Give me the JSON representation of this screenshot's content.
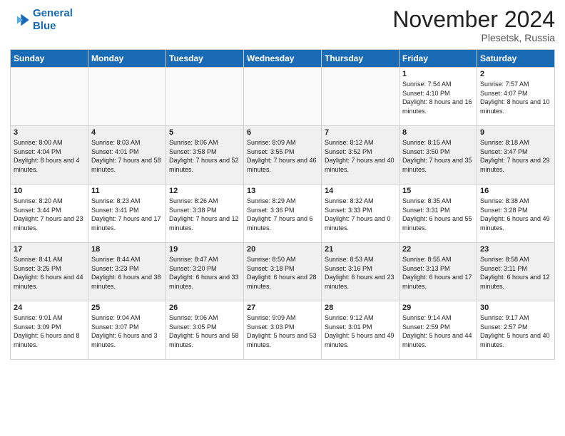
{
  "header": {
    "logo_line1": "General",
    "logo_line2": "Blue",
    "month_title": "November 2024",
    "location": "Plesetsk, Russia"
  },
  "days_of_week": [
    "Sunday",
    "Monday",
    "Tuesday",
    "Wednesday",
    "Thursday",
    "Friday",
    "Saturday"
  ],
  "weeks": [
    [
      {
        "day": "",
        "info": ""
      },
      {
        "day": "",
        "info": ""
      },
      {
        "day": "",
        "info": ""
      },
      {
        "day": "",
        "info": ""
      },
      {
        "day": "",
        "info": ""
      },
      {
        "day": "1",
        "info": "Sunrise: 7:54 AM\nSunset: 4:10 PM\nDaylight: 8 hours and 16 minutes."
      },
      {
        "day": "2",
        "info": "Sunrise: 7:57 AM\nSunset: 4:07 PM\nDaylight: 8 hours and 10 minutes."
      }
    ],
    [
      {
        "day": "3",
        "info": "Sunrise: 8:00 AM\nSunset: 4:04 PM\nDaylight: 8 hours and 4 minutes."
      },
      {
        "day": "4",
        "info": "Sunrise: 8:03 AM\nSunset: 4:01 PM\nDaylight: 7 hours and 58 minutes."
      },
      {
        "day": "5",
        "info": "Sunrise: 8:06 AM\nSunset: 3:58 PM\nDaylight: 7 hours and 52 minutes."
      },
      {
        "day": "6",
        "info": "Sunrise: 8:09 AM\nSunset: 3:55 PM\nDaylight: 7 hours and 46 minutes."
      },
      {
        "day": "7",
        "info": "Sunrise: 8:12 AM\nSunset: 3:52 PM\nDaylight: 7 hours and 40 minutes."
      },
      {
        "day": "8",
        "info": "Sunrise: 8:15 AM\nSunset: 3:50 PM\nDaylight: 7 hours and 35 minutes."
      },
      {
        "day": "9",
        "info": "Sunrise: 8:18 AM\nSunset: 3:47 PM\nDaylight: 7 hours and 29 minutes."
      }
    ],
    [
      {
        "day": "10",
        "info": "Sunrise: 8:20 AM\nSunset: 3:44 PM\nDaylight: 7 hours and 23 minutes."
      },
      {
        "day": "11",
        "info": "Sunrise: 8:23 AM\nSunset: 3:41 PM\nDaylight: 7 hours and 17 minutes."
      },
      {
        "day": "12",
        "info": "Sunrise: 8:26 AM\nSunset: 3:38 PM\nDaylight: 7 hours and 12 minutes."
      },
      {
        "day": "13",
        "info": "Sunrise: 8:29 AM\nSunset: 3:36 PM\nDaylight: 7 hours and 6 minutes."
      },
      {
        "day": "14",
        "info": "Sunrise: 8:32 AM\nSunset: 3:33 PM\nDaylight: 7 hours and 0 minutes."
      },
      {
        "day": "15",
        "info": "Sunrise: 8:35 AM\nSunset: 3:31 PM\nDaylight: 6 hours and 55 minutes."
      },
      {
        "day": "16",
        "info": "Sunrise: 8:38 AM\nSunset: 3:28 PM\nDaylight: 6 hours and 49 minutes."
      }
    ],
    [
      {
        "day": "17",
        "info": "Sunrise: 8:41 AM\nSunset: 3:25 PM\nDaylight: 6 hours and 44 minutes."
      },
      {
        "day": "18",
        "info": "Sunrise: 8:44 AM\nSunset: 3:23 PM\nDaylight: 6 hours and 38 minutes."
      },
      {
        "day": "19",
        "info": "Sunrise: 8:47 AM\nSunset: 3:20 PM\nDaylight: 6 hours and 33 minutes."
      },
      {
        "day": "20",
        "info": "Sunrise: 8:50 AM\nSunset: 3:18 PM\nDaylight: 6 hours and 28 minutes."
      },
      {
        "day": "21",
        "info": "Sunrise: 8:53 AM\nSunset: 3:16 PM\nDaylight: 6 hours and 23 minutes."
      },
      {
        "day": "22",
        "info": "Sunrise: 8:55 AM\nSunset: 3:13 PM\nDaylight: 6 hours and 17 minutes."
      },
      {
        "day": "23",
        "info": "Sunrise: 8:58 AM\nSunset: 3:11 PM\nDaylight: 6 hours and 12 minutes."
      }
    ],
    [
      {
        "day": "24",
        "info": "Sunrise: 9:01 AM\nSunset: 3:09 PM\nDaylight: 6 hours and 8 minutes."
      },
      {
        "day": "25",
        "info": "Sunrise: 9:04 AM\nSunset: 3:07 PM\nDaylight: 6 hours and 3 minutes."
      },
      {
        "day": "26",
        "info": "Sunrise: 9:06 AM\nSunset: 3:05 PM\nDaylight: 5 hours and 58 minutes."
      },
      {
        "day": "27",
        "info": "Sunrise: 9:09 AM\nSunset: 3:03 PM\nDaylight: 5 hours and 53 minutes."
      },
      {
        "day": "28",
        "info": "Sunrise: 9:12 AM\nSunset: 3:01 PM\nDaylight: 5 hours and 49 minutes."
      },
      {
        "day": "29",
        "info": "Sunrise: 9:14 AM\nSunset: 2:59 PM\nDaylight: 5 hours and 44 minutes."
      },
      {
        "day": "30",
        "info": "Sunrise: 9:17 AM\nSunset: 2:57 PM\nDaylight: 5 hours and 40 minutes."
      }
    ]
  ]
}
